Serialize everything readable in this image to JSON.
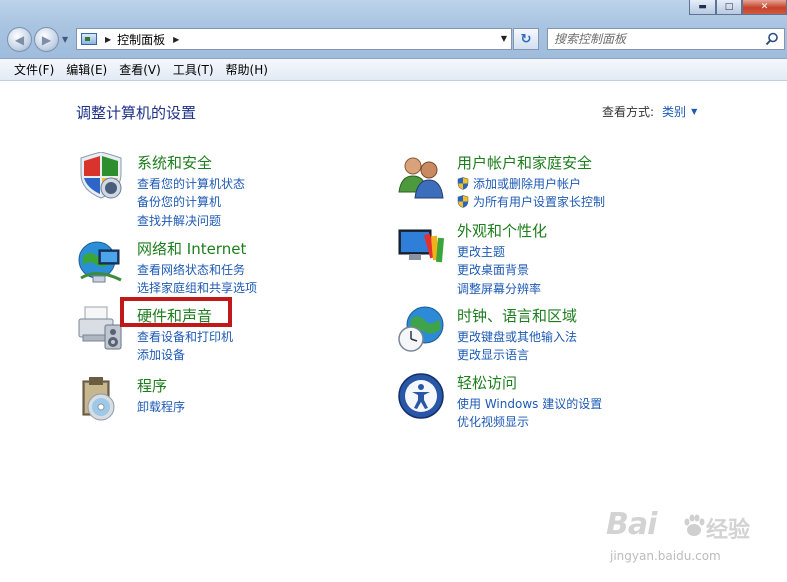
{
  "window": {
    "minimize_glyph": "▬",
    "maximize_glyph": "□",
    "close_glyph": "✕"
  },
  "navigation": {
    "back_glyph": "◀",
    "forward_glyph": "▶",
    "breadcrumb": [
      "控制面板"
    ],
    "search_placeholder": "搜索控制面板"
  },
  "menu": [
    "文件(F)",
    "编辑(E)",
    "查看(V)",
    "工具(T)",
    "帮助(H)"
  ],
  "header": {
    "title": "调整计算机的设置",
    "view_by_label": "查看方式:",
    "view_by_value": "类别"
  },
  "categories_left": [
    {
      "title": "系统和安全",
      "icon": "shield-icon",
      "links": [
        "查看您的计算机状态",
        "备份您的计算机",
        "查找并解决问题"
      ]
    },
    {
      "title": "网络和 Internet",
      "icon": "network-icon",
      "links": [
        "查看网络状态和任务",
        "选择家庭组和共享选项"
      ]
    },
    {
      "title": "硬件和声音",
      "icon": "printer-icon",
      "links": [
        "查看设备和打印机",
        "添加设备"
      ]
    },
    {
      "title": "程序",
      "icon": "programs-icon",
      "links": [
        "卸载程序"
      ]
    }
  ],
  "categories_right": [
    {
      "title": "用户帐户和家庭安全",
      "icon": "users-icon",
      "links": [
        "添加或删除用户帐户",
        "为所有用户设置家长控制"
      ]
    },
    {
      "title": "外观和个性化",
      "icon": "display-icon",
      "links": [
        "更改主题",
        "更改桌面背景",
        "调整屏幕分辨率"
      ]
    },
    {
      "title": "时钟、语言和区域",
      "icon": "clock-globe-icon",
      "links": [
        "更改键盘或其他输入法",
        "更改显示语言"
      ]
    },
    {
      "title": "轻松访问",
      "icon": "ease-of-access-icon",
      "links": [
        "使用 Windows 建议的设置",
        "优化视频显示"
      ]
    }
  ],
  "watermark": {
    "brand": "Bai",
    "brand_cn": "经验",
    "url": "jingyan.baidu.com"
  },
  "colors": {
    "category_title": "#1d7e1d",
    "link": "#1e5ab4",
    "heading": "#1e3287",
    "highlight": "#c0191a"
  }
}
